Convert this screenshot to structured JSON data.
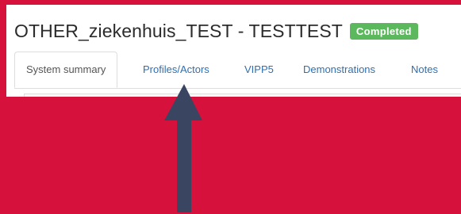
{
  "header": {
    "title": "OTHER_ziekenhuis_TEST - TESTTEST",
    "status_badge": "Completed"
  },
  "tabs": [
    {
      "label": "System summary",
      "active": true
    },
    {
      "label": "Profiles/Actors",
      "active": false
    },
    {
      "label": "VIPP5",
      "active": false
    },
    {
      "label": "Demonstrations",
      "active": false
    },
    {
      "label": "Notes",
      "active": false
    }
  ],
  "colors": {
    "background": "#d6123c",
    "badge": "#5cb85c",
    "link": "#2f6fb1",
    "arrow": "#3a4562"
  }
}
